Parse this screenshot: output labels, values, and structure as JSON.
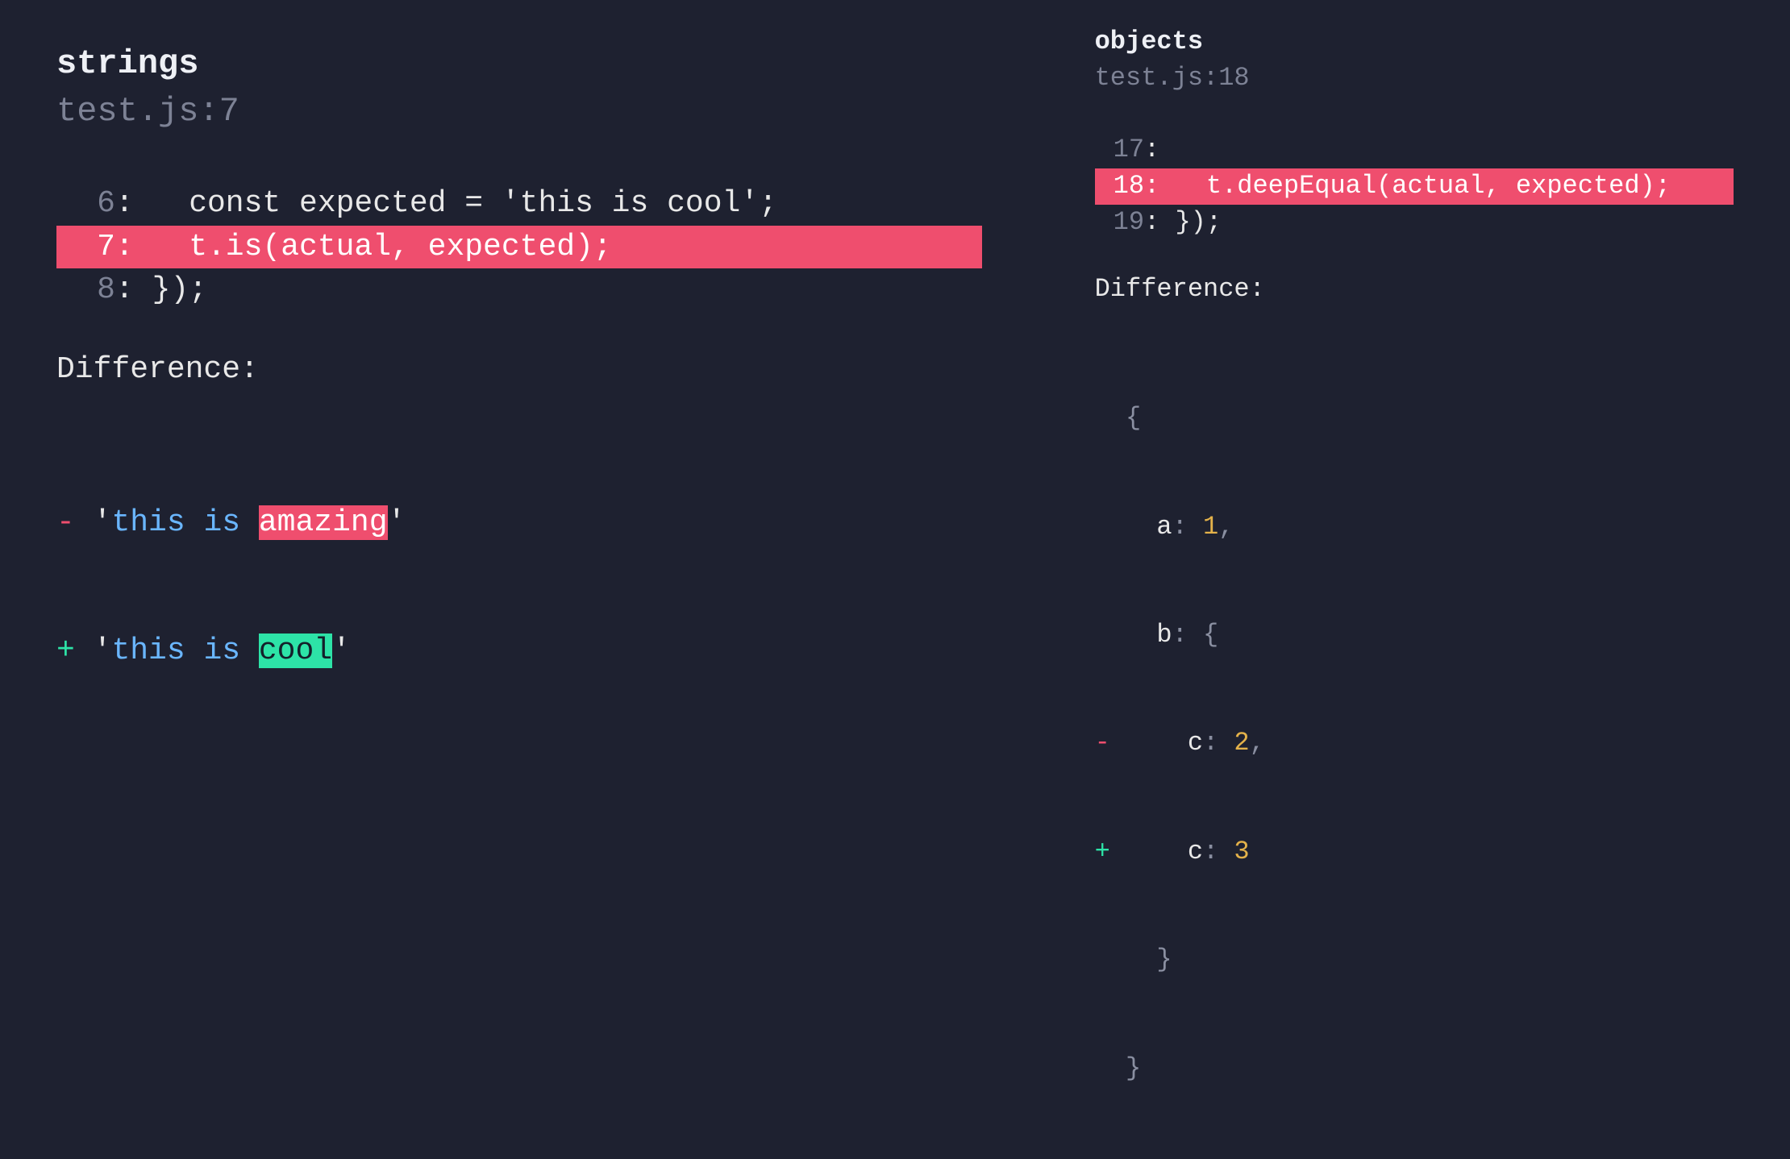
{
  "left": {
    "title": "strings",
    "location": "test.js:7",
    "code_lines": [
      {
        "num": "6",
        "prefix": ":   ",
        "content": "const expected = 'this is cool';",
        "highlighted": false
      },
      {
        "num": "7",
        "prefix": ":   ",
        "content": "t.is(actual, expected);           ",
        "highlighted": true
      },
      {
        "num": "8",
        "prefix": ": ",
        "content": "});",
        "highlighted": false
      }
    ],
    "diff_label": "Difference:",
    "diff": {
      "minus": {
        "marker": "-",
        "quote": "'",
        "before": "this is ",
        "changed": "amazing"
      },
      "plus": {
        "marker": "+",
        "quote": "'",
        "before": "this is ",
        "changed": "cool"
      }
    }
  },
  "right": {
    "title": "objects",
    "location": "test.js:18",
    "code_lines": [
      {
        "num": "17",
        "prefix": ":",
        "content": "",
        "highlighted": false
      },
      {
        "num": "18",
        "prefix": ":   ",
        "content": "t.deepEqual(actual, expected); ",
        "highlighted": true
      },
      {
        "num": "19",
        "prefix": ": ",
        "content": "});",
        "highlighted": false
      }
    ],
    "diff_label": "Difference:",
    "diff_obj": {
      "indent": "  ",
      "open": "{",
      "prop_a": "a",
      "colon": ": ",
      "val_a": "1",
      "comma": ",",
      "prop_b": "b",
      "open_b": "{",
      "minus_marker": "-",
      "plus_marker": "+",
      "prop_c": "c",
      "val_c_minus": "2",
      "val_c_plus": "3",
      "close_b": "}",
      "close": "}"
    }
  }
}
